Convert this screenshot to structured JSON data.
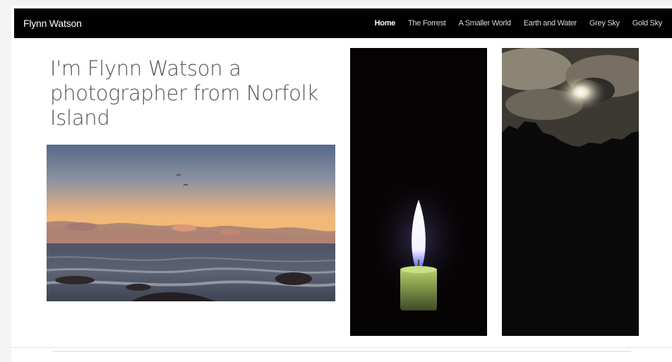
{
  "navbar": {
    "brand": "Flynn Watson",
    "links": [
      {
        "label": "Home",
        "active": true
      },
      {
        "label": "The Forrest",
        "active": false
      },
      {
        "label": "A Smaller World",
        "active": false
      },
      {
        "label": "Earth and Water",
        "active": false
      },
      {
        "label": "Grey Sky",
        "active": false
      },
      {
        "label": "Gold Sky",
        "active": false
      }
    ]
  },
  "hero": {
    "headline": "I'm Flynn Watson a photographer from Norfolk Island"
  },
  "colors": {
    "navbar_bg": "#000000",
    "page_bg": "#ffffff",
    "headline_text": "#555555",
    "sunset_sky_top": "#5d6f8d",
    "sunset_sky_bottom": "#f2b47a",
    "candle_flame": "#ffffff",
    "candle_wax": "#9dbd58"
  }
}
